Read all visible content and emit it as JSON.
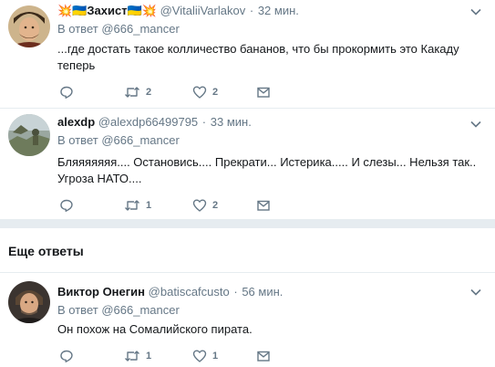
{
  "tweets": [
    {
      "name_prefix_emoji": "💥",
      "name_flag1": "🇺🇦",
      "name": "Захист",
      "name_flag2": "🇺🇦",
      "name_suffix_emoji": "💥",
      "handle": "@VitaliiVarlakov",
      "sep": "·",
      "time": "32 мин.",
      "reply_to_label": "В ответ",
      "reply_to_mention": "@666_mancer",
      "text": "...где достать такое колличество бананов, что бы прокормить это Какаду теперь",
      "retweets": "2",
      "likes": "2"
    },
    {
      "name": "alexdp",
      "handle": "@alexdp66499795",
      "sep": "·",
      "time": "33 мин.",
      "reply_to_label": "В ответ",
      "reply_to_mention": "@666_mancer",
      "text": "Бляяяяяяя.... Остановись.... Прекрати... Истерика..... И слезы... Нельзя так.. Угроза НАТО....",
      "retweets": "1",
      "likes": "2"
    },
    {
      "name": "Виктор Онегин",
      "handle": "@batiscafcusto",
      "sep": "·",
      "time": "56 мин.",
      "reply_to_label": "В ответ",
      "reply_to_mention": "@666_mancer",
      "text": "Он похож на Сомалийского пирата.",
      "retweets": "1",
      "likes": "1"
    }
  ],
  "more_replies_title": "Еще ответы",
  "colors": {
    "text": "#14171a",
    "secondary": "#657786",
    "divider": "#e6ecf0",
    "background": "#ffffff"
  },
  "icons": [
    "reply-icon",
    "retweet-icon",
    "like-icon",
    "direct-message-icon",
    "chevron-down-icon"
  ]
}
